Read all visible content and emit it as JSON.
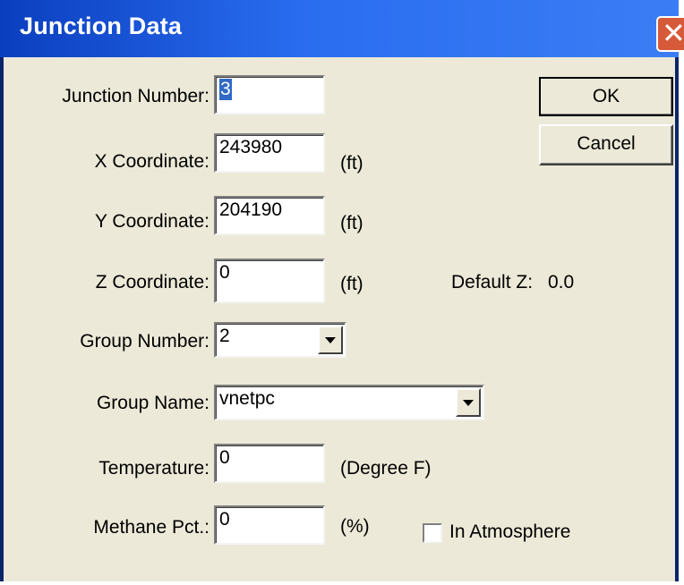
{
  "window": {
    "title": "Junction Data",
    "close_glyph": "✕"
  },
  "buttons": {
    "ok": "OK",
    "cancel": "Cancel"
  },
  "fields": {
    "junction_number": {
      "label": "Junction Number:",
      "value": "3"
    },
    "x": {
      "label": "X Coordinate:",
      "value": "243980",
      "unit": "(ft)"
    },
    "y": {
      "label": "Y Coordinate:",
      "value": "204190",
      "unit": "(ft)"
    },
    "z": {
      "label": "Z Coordinate:",
      "value": "0",
      "unit": "(ft)"
    },
    "default_z": {
      "label": "Default Z:",
      "value": "0.0"
    },
    "group_number": {
      "label": "Group Number:",
      "value": "2"
    },
    "group_name": {
      "label": "Group Name:",
      "value": "vnetpc"
    },
    "temperature": {
      "label": "Temperature:",
      "value": "0",
      "unit": "(Degree F)"
    },
    "methane_pct": {
      "label": "Methane Pct.:",
      "value": "0",
      "unit": "(%)"
    },
    "in_atmosphere": {
      "label": "In Atmosphere",
      "checked": false
    }
  },
  "icons": {
    "close": "close-icon",
    "dropdown": "chevron-down-icon"
  }
}
